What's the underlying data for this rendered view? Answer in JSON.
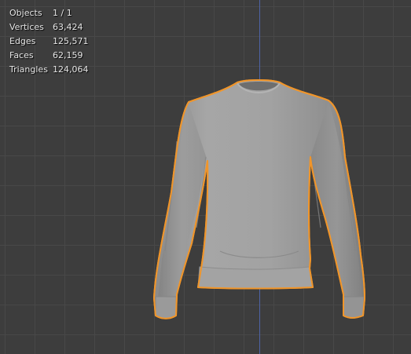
{
  "overlay": {
    "statistics": [
      {
        "label": "Objects",
        "value": "1 / 1"
      },
      {
        "label": "Vertices",
        "value": "63,424"
      },
      {
        "label": "Edges",
        "value": "125,571"
      },
      {
        "label": "Faces",
        "value": "62,159"
      },
      {
        "label": "Triangles",
        "value": "124,064"
      }
    ]
  },
  "colors": {
    "viewport_background": "#3d3d3d",
    "grid_line": "#484848",
    "z_axis": "#4e63a6",
    "selection_outline": "#f0952a",
    "mesh": "#9c9c9c"
  }
}
